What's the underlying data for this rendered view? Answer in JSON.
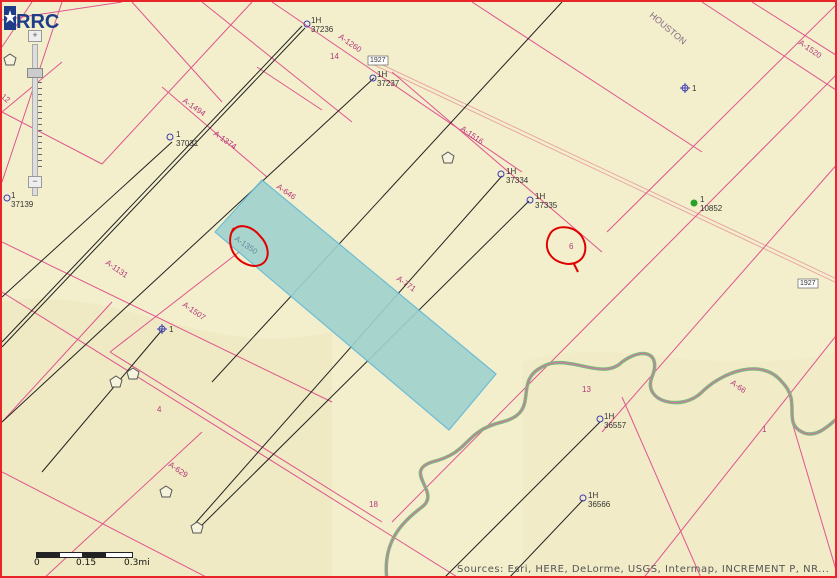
{
  "map": {
    "county_label": "HOUSTON",
    "road_shields": [
      "1927",
      "1927"
    ],
    "abstracts": [
      "A-1260",
      "A-1494",
      "A-1374",
      "A-646",
      "A-1516",
      "A-1520",
      "A-1131",
      "A-1350",
      "A-1507",
      "A-771",
      "A-629",
      "A-66"
    ],
    "survey_numbers": [
      "14",
      "12",
      "4",
      "18",
      "13",
      "1",
      "6"
    ],
    "wells": [
      {
        "id": "w1",
        "line1": "1H",
        "line2": "37236"
      },
      {
        "id": "w2",
        "line1": "1H",
        "line2": "37237"
      },
      {
        "id": "w3",
        "line1": "1",
        "line2": "37031"
      },
      {
        "id": "w4",
        "line1": "1",
        "line2": "37139"
      },
      {
        "id": "w5",
        "line1": "1H",
        "line2": "37334"
      },
      {
        "id": "w6",
        "line1": "1H",
        "line2": "37335"
      },
      {
        "id": "w7",
        "line1": "1",
        "line2": ""
      },
      {
        "id": "w8",
        "line1": "1",
        "line2": "10852"
      },
      {
        "id": "w9",
        "line1": "1",
        "line2": ""
      },
      {
        "id": "w10",
        "line1": "1H",
        "line2": "36557"
      },
      {
        "id": "w11",
        "line1": "1H",
        "line2": "36566"
      }
    ],
    "highlight_color": "#9fd3cf",
    "boundary_color": "#e0558f",
    "annotation_color": "#e00000"
  },
  "scalebar": {
    "labels": [
      "0",
      "0.15",
      "0.3mi"
    ]
  },
  "attribution": "Sources: Esri, HERE, DeLorme, USGS, Intermap, INCREMENT P, NR...",
  "logo": {
    "text": "RRC"
  }
}
